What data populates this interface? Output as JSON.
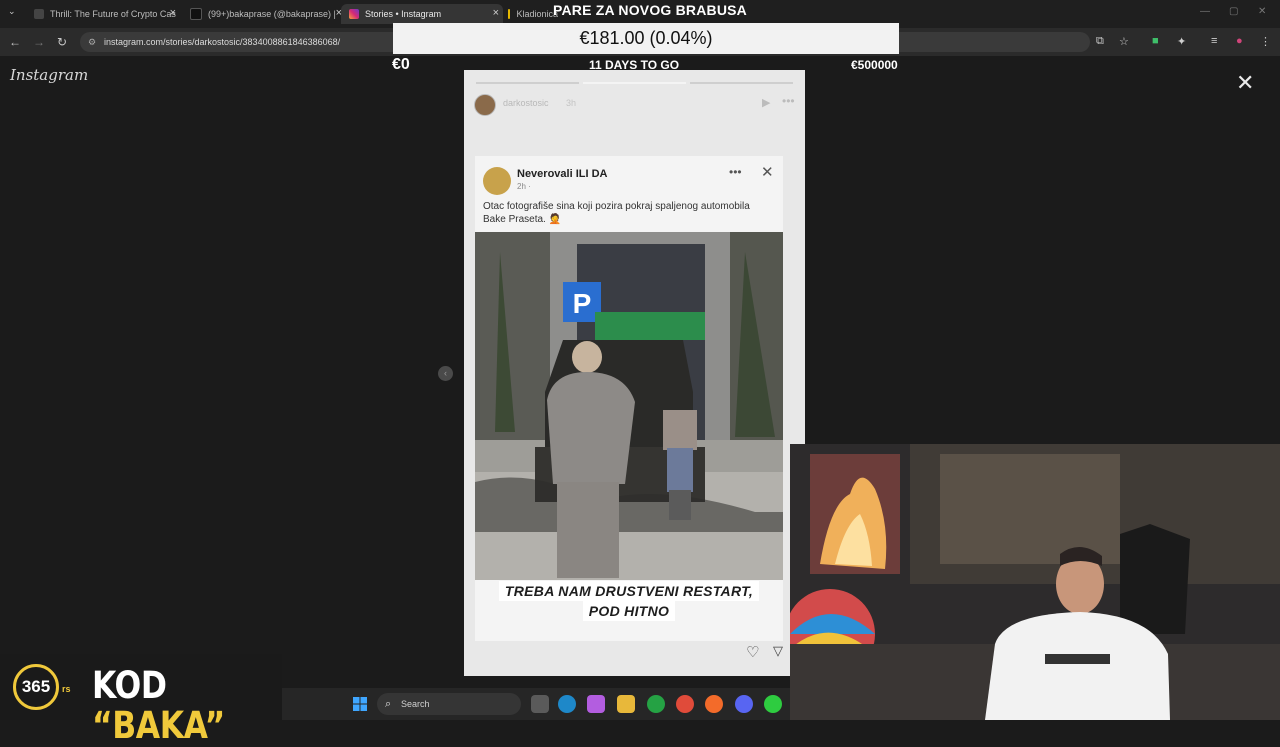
{
  "browser": {
    "tabs": [
      {
        "title": "Thrill: The Future of Crypto Cas",
        "active": false
      },
      {
        "title": "(99+)bakaprase (@bakaprase) |",
        "active": false
      },
      {
        "title": "Stories • Instagram",
        "active": true
      },
      {
        "title": "Kladionica",
        "active": false
      }
    ],
    "url": "instagram.com/stories/darkostosic/3834008861846386068/"
  },
  "donation_overlay": {
    "title": "PARE ZA NOVOG BRABUSA",
    "current": "€181.00 (0.04%)",
    "start": "€0",
    "days_left": "11 DAYS TO GO",
    "goal": "€500000",
    "progress_percent": 0.04
  },
  "instagram": {
    "logo": "Instagram",
    "story": {
      "username": "darkostosic",
      "time_ago": "3h",
      "progress_segments": 3,
      "active_segment": 2
    },
    "post": {
      "author": "Neverovali ILI DA",
      "meta": "2h ·",
      "caption": "Otac fotografiše sina koji pozira pokraj spaljenog automobila Bake Praseta. 🤦",
      "headline_line1": "TREBA NAM DRUSTVENI RESTART,",
      "headline_line2": "POD HITNO"
    }
  },
  "promo": {
    "logo": "365",
    "suffix": "rs",
    "code_label": "KOD",
    "code": "“BAKA”"
  },
  "taskbar": {
    "search_placeholder": "Search"
  },
  "colors": {
    "overlay_box": "#f2f2f2",
    "promo_accent": "#f0c93b",
    "background": "#1b1b1b"
  }
}
